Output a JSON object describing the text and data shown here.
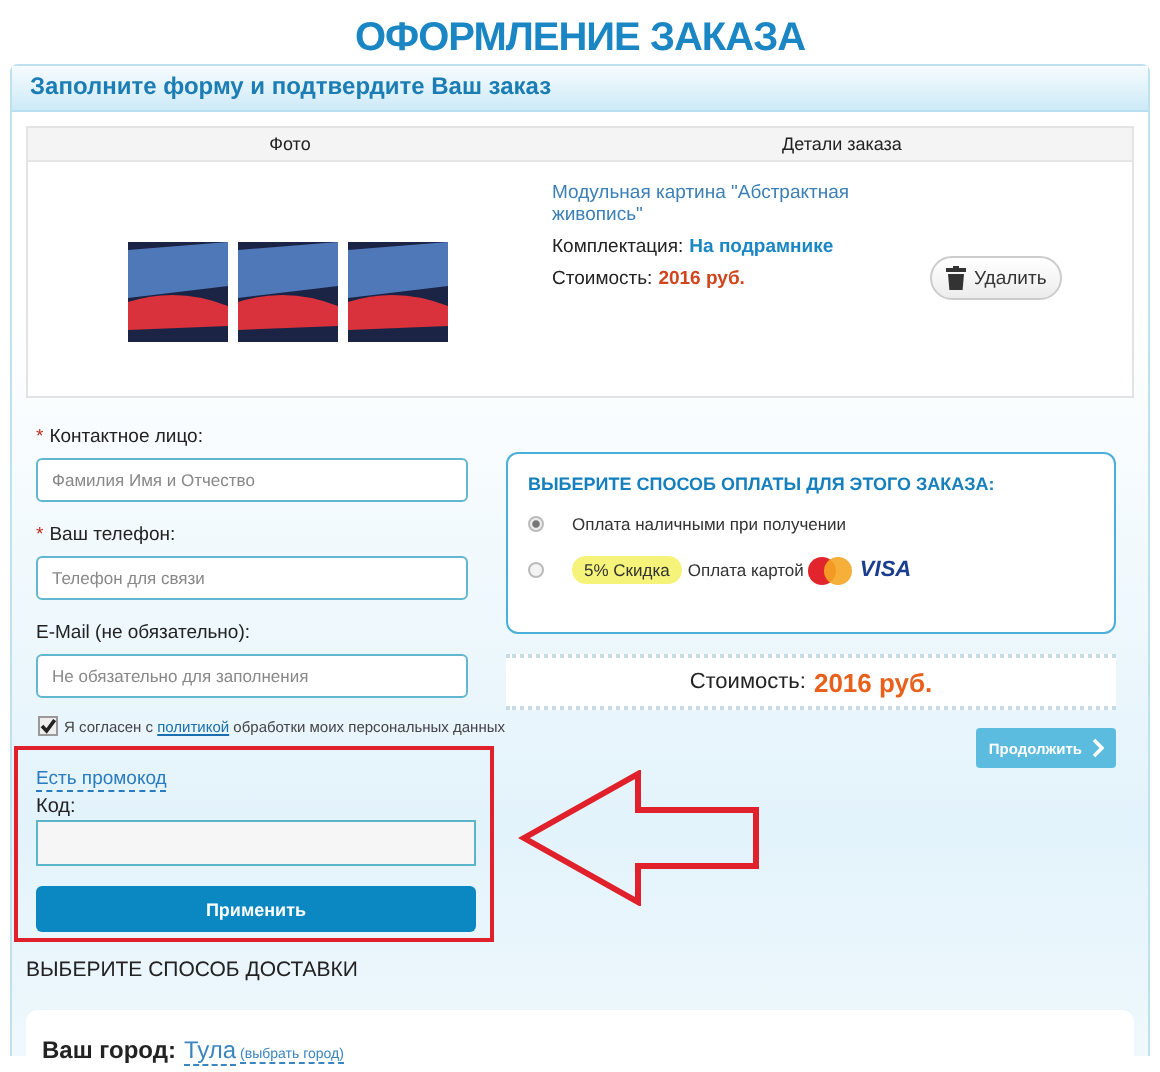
{
  "page_title": "ОФОРМЛЕНИЕ ЗАКАЗА",
  "panel": {
    "title": "Заполните форму и подтвердите Ваш заказ"
  },
  "order_table": {
    "columns": [
      "Фото",
      "Детали заказа"
    ],
    "rows": [
      {
        "name": "Модульная картина \"Абстрактная живопись\"",
        "option_label": "Комплектация:",
        "option_value": "На подрамнике",
        "price_label": "Стоимость:",
        "price_value": "2016 руб.",
        "delete_button": "Удалить"
      }
    ]
  },
  "contact_fields": [
    {
      "required_mark": "*",
      "label": "Контактное лицо:",
      "placeholder": "Фамилия Имя и Отчество"
    },
    {
      "required_mark": "*",
      "label": "Ваш телефон:",
      "placeholder": "Телефон для связи"
    },
    {
      "label": "E-Mail (не обязательно):",
      "placeholder": "Не обязательно для заполнения"
    }
  ],
  "consent": {
    "checked": true,
    "before": "Я согласен с ",
    "link": "политикой",
    "after": " обработки моих персональных данных"
  },
  "payment": {
    "title": "ВЫБЕРИТЕ СПОСОБ ОПЛАТЫ ДЛЯ ЭТОГО ЗАКАЗА:",
    "options": [
      {
        "selected": true,
        "label": "Оплата наличными при получении"
      },
      {
        "selected": false,
        "badge": "5% Скидка",
        "label": "Оплата картой",
        "visa": "VISA"
      }
    ]
  },
  "total": {
    "label": "Стоимость:",
    "value": "2016 руб."
  },
  "continue_button": "Продолжить",
  "promo": {
    "link": "Есть промокод",
    "code_label": "Код:",
    "apply_button": "Применить"
  },
  "delivery": {
    "title": "ВЫБЕРИТЕ СПОСОБ ДОСТАВКИ",
    "city_label": "Ваш город:",
    "city": "Тула",
    "change_link": "(выбрать город)"
  }
}
